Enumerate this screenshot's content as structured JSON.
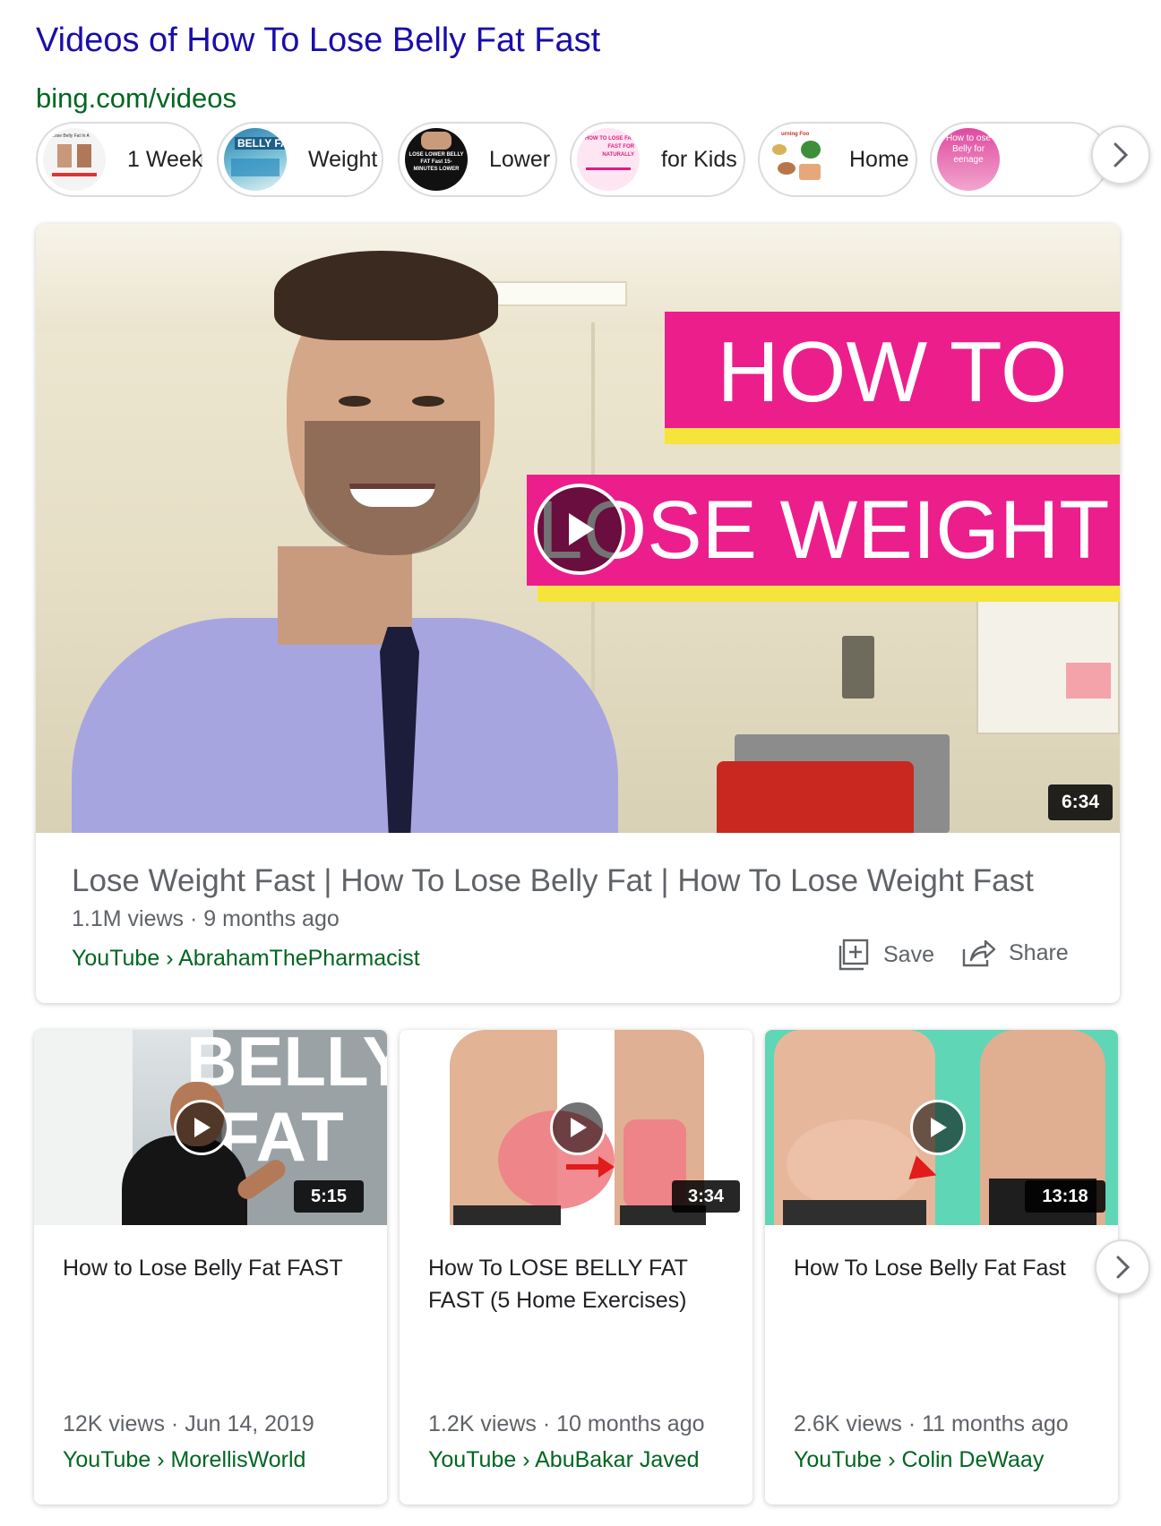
{
  "header": {
    "title": "Videos of How To Lose Belly Fat Fast",
    "source_url": "bing.com/videos"
  },
  "chips": [
    {
      "label": "1 Week",
      "thumb_text": "o Lose Belly Fat In A"
    },
    {
      "label": "Weight",
      "thumb_text": "BELLY FA"
    },
    {
      "label": "Lower",
      "thumb_text": "LOSE LOWER BELLY FAT Fast 15-MINUTES LOWER"
    },
    {
      "label": "for Kids",
      "thumb_text": "HOW TO LOSE FAT FAST FOR NATURALLY"
    },
    {
      "label": "Home",
      "thumb_text": "urning Foo"
    },
    {
      "label": "",
      "thumb_text": "How to ose Belly for eenage"
    }
  ],
  "featured": {
    "overlay_line1": "HOW TO",
    "overlay_line2": "LOSE WEIGHT",
    "duration": "6:34",
    "title": "Lose Weight Fast | How To Lose Belly Fat | How To Lose Weight Fast",
    "views": "1.1M views",
    "age": "9 months ago",
    "source": "YouTube",
    "channel": "AbrahamThePharmacist",
    "save_label": "Save",
    "share_label": "Share"
  },
  "videos": [
    {
      "thumb_text_1": "BELLY",
      "thumb_text_2": "FAT",
      "duration": "5:15",
      "title": "How to Lose Belly Fat FAST",
      "views": "12K views",
      "age": "Jun 14, 2019",
      "source": "YouTube",
      "channel": "MorellisWorld"
    },
    {
      "duration": "3:34",
      "title": "How To LOSE BELLY FAT FAST (5 Home Exercises)",
      "views": "1.2K views",
      "age": "10 months ago",
      "source": "YouTube",
      "channel": "AbuBakar Javed"
    },
    {
      "duration": "13:18",
      "title": "How To Lose Belly Fat Fast",
      "views": "2.6K views",
      "age": "11 months ago",
      "source": "YouTube",
      "channel": "Colin DeWaay"
    }
  ],
  "separators": {
    "dot": "·",
    "breadcrumb": "›"
  },
  "colors": {
    "title_link": "#1a0dab",
    "source_green": "#006621",
    "overlay_pink": "#ec1e8c",
    "overlay_yellow": "#f5e43a"
  }
}
